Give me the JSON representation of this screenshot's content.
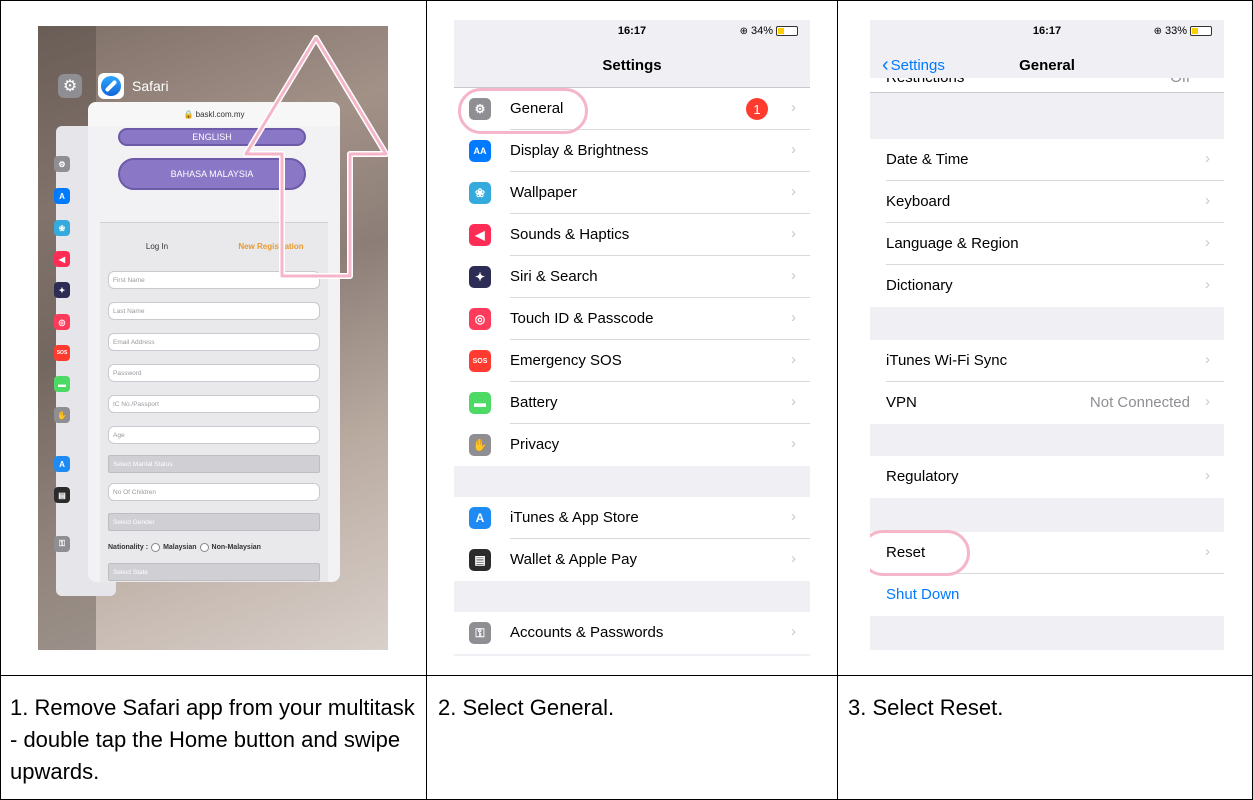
{
  "captions": [
    "1. Remove Safari app from your multitask - double tap the Home button and swipe upwards.",
    "2. Select General.",
    "3. Select Reset."
  ],
  "panel1": {
    "app_name": "Safari",
    "url": "🔒 baskl.com.my",
    "buttons": [
      "ENGLISH",
      "BAHASA MALAYSIA"
    ],
    "tabs": {
      "login": "Log In",
      "registration": "New Registration"
    },
    "fields": [
      "First Name",
      "Last Name",
      "Email Address",
      "Password",
      "IC No./Passport",
      "Age"
    ],
    "select_marital": "Select Marital Status",
    "children": "No Of Children",
    "select_gender": "Select Gender",
    "nationality_label": "Nationality :",
    "nationality_options": [
      "Malaysian",
      "Non-Malaysian"
    ],
    "select_state": "Select State"
  },
  "panel2": {
    "time": "16:17",
    "battery": "34%",
    "title": "Settings",
    "general_badge": "1",
    "group1": [
      {
        "label": "General",
        "icon": "gear-icon",
        "color": "#8e8e93",
        "glyph": "⚙"
      },
      {
        "label": "Display & Brightness",
        "icon": "display-icon",
        "color": "#007aff",
        "glyph": "AA"
      },
      {
        "label": "Wallpaper",
        "icon": "wallpaper-icon",
        "color": "#35aadc",
        "glyph": "❀"
      },
      {
        "label": "Sounds & Haptics",
        "icon": "speaker-icon",
        "color": "#ff2d55",
        "glyph": "◀"
      },
      {
        "label": "Siri & Search",
        "icon": "siri-icon",
        "color": "#2c2c54",
        "glyph": "✦"
      },
      {
        "label": "Touch ID & Passcode",
        "icon": "fingerprint-icon",
        "color": "#ff3b5c",
        "glyph": "◎"
      },
      {
        "label": "Emergency SOS",
        "icon": "sos-icon",
        "color": "#ff3b30",
        "glyph": "SOS"
      },
      {
        "label": "Battery",
        "icon": "battery-icon",
        "color": "#4cd964",
        "glyph": "▬"
      },
      {
        "label": "Privacy",
        "icon": "hand-icon",
        "color": "#8e8e93",
        "glyph": "✋"
      }
    ],
    "group2": [
      {
        "label": "iTunes & App Store",
        "icon": "app-store-icon",
        "color": "#1e8bf5",
        "glyph": "A"
      },
      {
        "label": "Wallet & Apple Pay",
        "icon": "wallet-icon",
        "color": "#2b2b2b",
        "glyph": "▤"
      }
    ],
    "group3": [
      {
        "label": "Accounts & Passwords",
        "icon": "key-icon",
        "color": "#8e8e93",
        "glyph": "⚿"
      }
    ]
  },
  "panel3": {
    "time": "16:17",
    "battery": "33%",
    "back_label": "Settings",
    "title": "General",
    "cut_off_row": "Restrictions",
    "cut_off_value": "Off",
    "group1": [
      "Date & Time",
      "Keyboard",
      "Language & Region",
      "Dictionary"
    ],
    "group2": [
      {
        "label": "iTunes Wi-Fi Sync",
        "value": ""
      },
      {
        "label": "VPN",
        "value": "Not Connected"
      }
    ],
    "regulatory": "Regulatory",
    "reset": "Reset",
    "shut_down": "Shut Down"
  },
  "colors": {
    "ios_blue": "#007aff",
    "highlight_pink": "#f4b6c8",
    "badge_red": "#ff3b30",
    "registration_orange": "#e89a2f",
    "purple_button": "#8a77c5"
  }
}
